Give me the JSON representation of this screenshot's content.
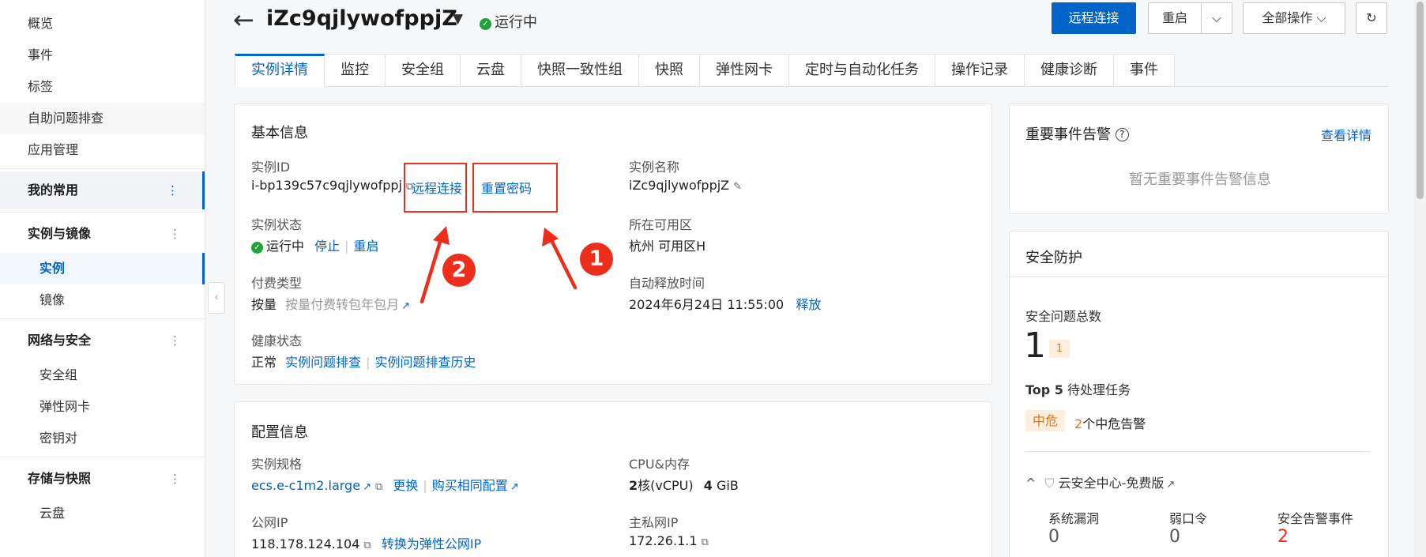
{
  "sidebar": {
    "top_items": [
      "概览",
      "事件",
      "标签",
      "自助问题排查",
      "应用管理"
    ],
    "my_common": "我的常用",
    "groups": [
      {
        "label": "实例与镜像",
        "items": [
          "实例",
          "镜像"
        ]
      },
      {
        "label": "网络与安全",
        "items": [
          "安全组",
          "弹性网卡",
          "密钥对"
        ]
      },
      {
        "label": "存储与快照",
        "items": [
          "云盘"
        ]
      }
    ],
    "kebab": "⋮",
    "collapse": "‹"
  },
  "header": {
    "back": "←",
    "title": "iZc9qjlywofppjZ",
    "caret": "▼",
    "status": "运行中",
    "check": "✓",
    "btn_remote": "远程连接",
    "btn_restart": "重启",
    "btn_dropdown": "⌵",
    "btn_all_ops": "全部操作 ⌵",
    "btn_refresh": "↻"
  },
  "tabs": [
    "实例详情",
    "监控",
    "安全组",
    "云盘",
    "快照一致性组",
    "快照",
    "弹性网卡",
    "定时与自动化任务",
    "操作记录",
    "健康诊断",
    "事件"
  ],
  "basic": {
    "title": "基本信息",
    "id_label": "实例ID",
    "id_value": "i-bp139c57c9qjlywofppj",
    "remote_link": "远程连接",
    "reset_pwd_link": "重置密码",
    "name_label": "实例名称",
    "name_value": "iZc9qjlywofppjZ",
    "state_label": "实例状态",
    "state_value": "运行中",
    "stop_link": "停止",
    "restart_link": "重启",
    "zone_label": "所在可用区",
    "zone_value": "杭州 可用区H",
    "pay_label": "付费类型",
    "pay_value": "按量",
    "pay_convert": "按量付费转包年包月",
    "release_label": "自动释放时间",
    "release_value": "2024年6月24日 11:55:00",
    "release_link": "释放",
    "health_label": "健康状态",
    "health_value": "正常",
    "health_link1": "实例问题排查",
    "health_link2": "实例问题排查历史"
  },
  "annotations": {
    "one": "1",
    "two": "2",
    "color": "#e8301f"
  },
  "config": {
    "title": "配置信息",
    "spec_label": "实例规格",
    "spec_value": "ecs.e-c1m2.large",
    "change_link": "更换",
    "buy_link": "购买相同配置",
    "cpu_label": "CPU&内存",
    "cpu_num": "2",
    "cpu_unit": "核(vCPU)",
    "mem_num": "4",
    "mem_unit": "GiB",
    "pubip_label": "公网IP",
    "pubip_value": "118.178.124.104",
    "convert_eip": "转换为弹性公网IP",
    "privip_label": "主私网IP",
    "privip_value": "172.26.1.1"
  },
  "alerts": {
    "title": "重要事件告警",
    "help": "?",
    "details_link": "查看详情",
    "empty": "暂无重要事件告警信息"
  },
  "security": {
    "title": "安全防护",
    "total_label": "安全问题总数",
    "total_value": "1",
    "total_tag": "1",
    "top5_bold": "Top 5",
    "top5_rest": "待处理任务",
    "mid_tag": "中危",
    "mid_count": "2",
    "mid_text": "个中危告警",
    "center_caret": "^",
    "center_label": "云安全中心-免费版",
    "vuln_label": "系统漏洞",
    "vuln_value": "0",
    "weak_label": "弱口令",
    "weak_value": "0",
    "event_label": "安全告警事件",
    "event_value": "2"
  },
  "colors": {
    "accent": "#0064c8",
    "success": "#21a33a",
    "danger": "#ee2e1d",
    "warning": "#e07712"
  }
}
